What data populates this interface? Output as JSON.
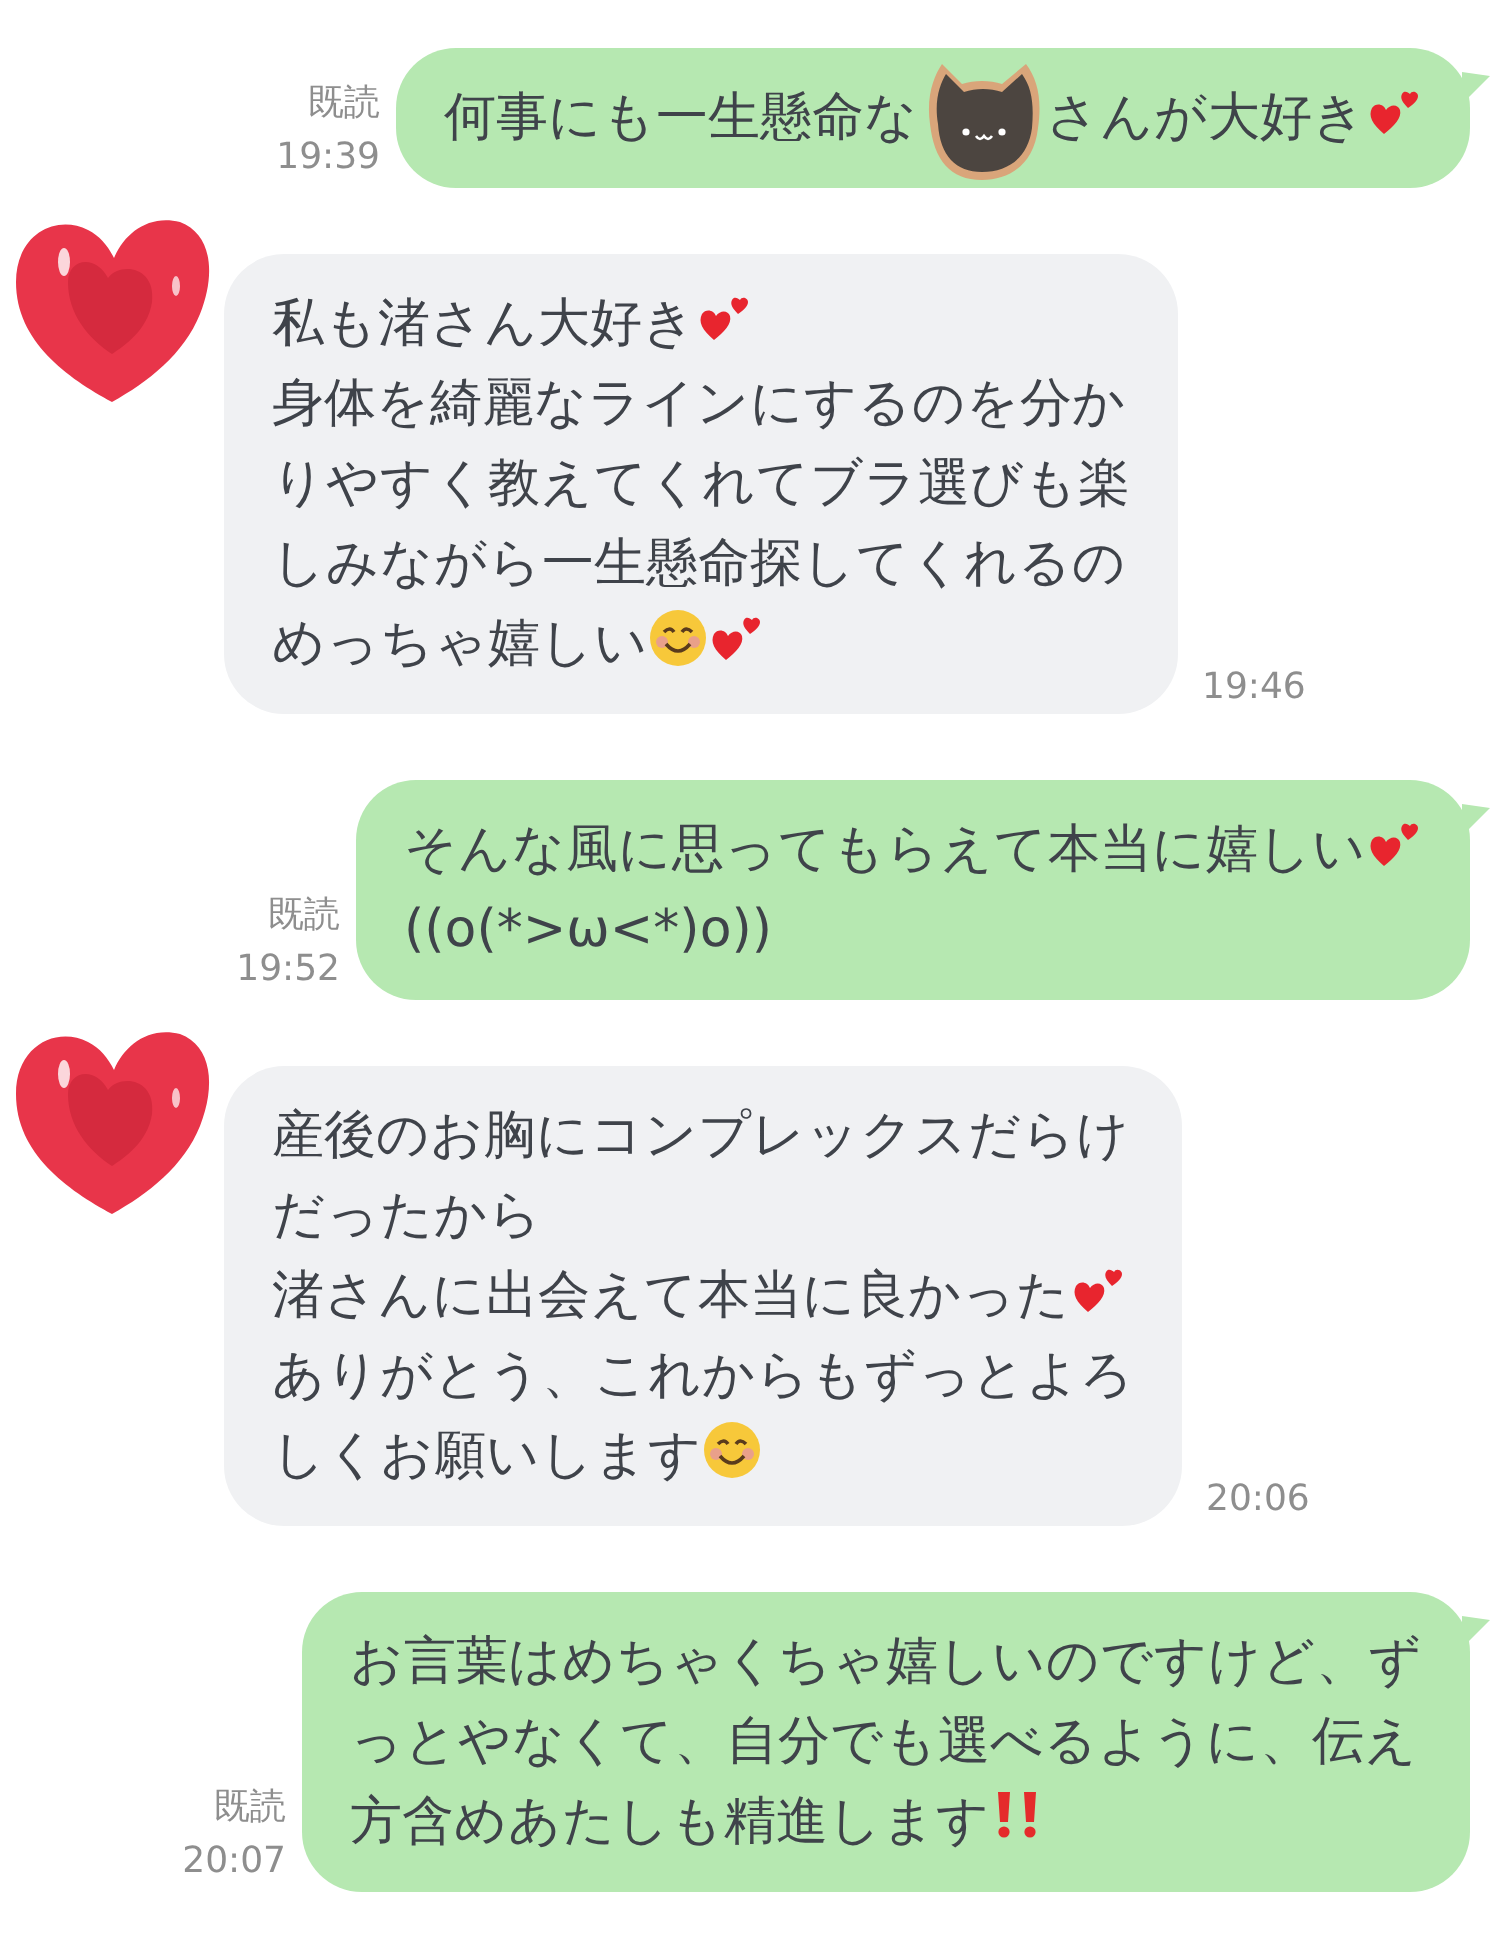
{
  "messages": [
    {
      "kind": "outgoing",
      "read": "既読",
      "time": "19:39",
      "lines": [
        [
          {
            "kind": "text",
            "text": "何事にも一生懸命な"
          },
          {
            "kind": "sticker"
          },
          {
            "kind": "text",
            "text": "さんが大好き"
          },
          {
            "kind": "hearts"
          }
        ]
      ]
    },
    {
      "kind": "incoming",
      "time": "19:46",
      "lines": [
        [
          {
            "kind": "text",
            "text": "私も渚さん大好き"
          },
          {
            "kind": "hearts"
          }
        ],
        [
          {
            "kind": "text",
            "text": "身体を綺麗なラインにするのを分か"
          }
        ],
        [
          {
            "kind": "text",
            "text": "りやすく教えてくれてブラ選びも楽"
          }
        ],
        [
          {
            "kind": "text",
            "text": "しみながら一生懸命探してくれるの"
          }
        ],
        [
          {
            "kind": "text",
            "text": "めっちゃ嬉しい"
          },
          {
            "kind": "smile"
          },
          {
            "kind": "hearts"
          }
        ]
      ]
    },
    {
      "kind": "outgoing",
      "read": "既読",
      "time": "19:52",
      "lines": [
        [
          {
            "kind": "text",
            "text": "そんな風に思ってもらえて本当に嬉しい"
          },
          {
            "kind": "hearts"
          }
        ],
        [
          {
            "kind": "text",
            "text": "((o(*>ω<*)o))"
          }
        ]
      ]
    },
    {
      "kind": "incoming",
      "time": "20:06",
      "lines": [
        [
          {
            "kind": "text",
            "text": "産後のお胸にコンプレックスだらけ"
          }
        ],
        [
          {
            "kind": "text",
            "text": "だったから"
          }
        ],
        [
          {
            "kind": "text",
            "text": "渚さんに出会えて本当に良かった"
          },
          {
            "kind": "hearts"
          }
        ],
        [
          {
            "kind": "text",
            "text": "ありがとう、これからもずっとよろ"
          }
        ],
        [
          {
            "kind": "text",
            "text": "しくお願いします"
          },
          {
            "kind": "smile"
          }
        ]
      ]
    },
    {
      "kind": "outgoing",
      "read": "既読",
      "time": "20:07",
      "lines": [
        [
          {
            "kind": "text",
            "text": "お言葉はめちゃくちゃ嬉しいのですけど、ず"
          }
        ],
        [
          {
            "kind": "text",
            "text": "っとやなくて、自分でも選べるように、伝え"
          }
        ],
        [
          {
            "kind": "text",
            "text": "方含めあたしも精進します"
          },
          {
            "kind": "exclaim"
          }
        ]
      ]
    }
  ]
}
